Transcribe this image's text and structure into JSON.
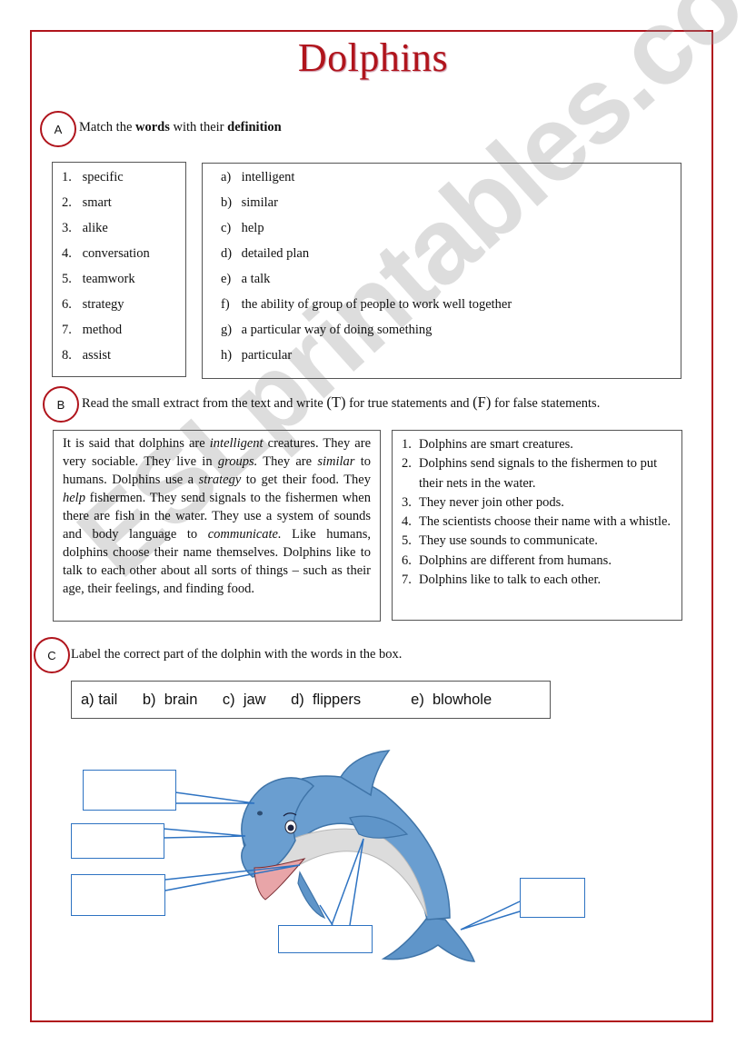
{
  "title": "Dolphins",
  "section_a": {
    "marker": "A",
    "instruction_parts": [
      {
        "text": "Match the ",
        "bold": false
      },
      {
        "text": "words",
        "bold": true
      },
      {
        "text": " with their ",
        "bold": false
      },
      {
        "text": "definition",
        "bold": true
      }
    ],
    "words": [
      {
        "num": "1.",
        "word": "specific"
      },
      {
        "num": "2.",
        "word": "smart"
      },
      {
        "num": "3.",
        "word": "alike"
      },
      {
        "num": "4.",
        "word": "conversation"
      },
      {
        "num": "5.",
        "word": "teamwork"
      },
      {
        "num": "6.",
        "word": "strategy"
      },
      {
        "num": "7.",
        "word": "method"
      },
      {
        "num": "8.",
        "word": "assist"
      }
    ],
    "definitions": [
      {
        "letter": "a)",
        "text": "intelligent"
      },
      {
        "letter": "b)",
        "text": "similar"
      },
      {
        "letter": "c)",
        "text": "help"
      },
      {
        "letter": "d)",
        "text": "detailed plan"
      },
      {
        "letter": "e)",
        "text": "a talk"
      },
      {
        "letter": "f)",
        "text": "the ability of group of people to work well together"
      },
      {
        "letter": "g)",
        "text": "a particular way of doing something"
      },
      {
        "letter": "h)",
        "text": "particular"
      }
    ]
  },
  "section_b": {
    "marker": "B",
    "instruction_parts": [
      {
        "text": "Read the small extract from the text and write ",
        "bold": false
      },
      {
        "text": "(T)",
        "bold": false,
        "large": true
      },
      {
        "text": " for true statements and ",
        "bold": false
      },
      {
        "text": "(F)",
        "bold": false,
        "large": true
      },
      {
        "text": " for false statements.",
        "bold": false
      }
    ],
    "extract": [
      {
        "text": "It is said that dolphins are ",
        "italic": false
      },
      {
        "text": "intelligent",
        "italic": true
      },
      {
        "text": " creatures. They are very sociable. They live in ",
        "italic": false
      },
      {
        "text": "groups.",
        "italic": true
      },
      {
        "text": " They are ",
        "italic": false
      },
      {
        "text": "similar",
        "italic": true
      },
      {
        "text": " to humans. Dolphins use a ",
        "italic": false
      },
      {
        "text": "strategy",
        "italic": true
      },
      {
        "text": " to get their food. They ",
        "italic": false
      },
      {
        "text": "help",
        "italic": true
      },
      {
        "text": " fishermen. They send signals to the fishermen when there are fish in the water. They use a system of sounds and body language to ",
        "italic": false
      },
      {
        "text": "communicate.",
        "italic": true
      },
      {
        "text": " Like humans, dolphins choose their name themselves. Dolphins like to talk to each other about all sorts of things – such as their age, their feelings, and finding food.",
        "italic": false
      }
    ],
    "statements": [
      {
        "num": "1.",
        "text": "Dolphins are smart creatures."
      },
      {
        "num": "2.",
        "text": "Dolphins send signals to the fishermen to put their nets in the water."
      },
      {
        "num": "3.",
        "text": "They never join other pods."
      },
      {
        "num": "4.",
        "text": "The scientists choose their name with a whistle."
      },
      {
        "num": "5.",
        "text": "They use sounds to communicate."
      },
      {
        "num": "6.",
        "text": "Dolphins are different from humans."
      },
      {
        "num": "7.",
        "text": "Dolphins like to talk to each other."
      }
    ]
  },
  "section_c": {
    "marker": "C",
    "instruction": "Label the correct part of the dolphin with the words in the box.",
    "word_box": [
      "a) tail",
      "b)  brain",
      "c)  jaw",
      "d)  flippers",
      "e)  blowhole"
    ],
    "label_boxes": [
      "",
      "",
      "",
      "",
      ""
    ],
    "image": "dolphin-illustration"
  },
  "watermark": "ESLprintables.com",
  "colors": {
    "accent_red": "#b0141c",
    "label_blue": "#2e73c2",
    "dolphin_blue": "#6a9ed0",
    "dolphin_belly": "#dcdcdc"
  }
}
